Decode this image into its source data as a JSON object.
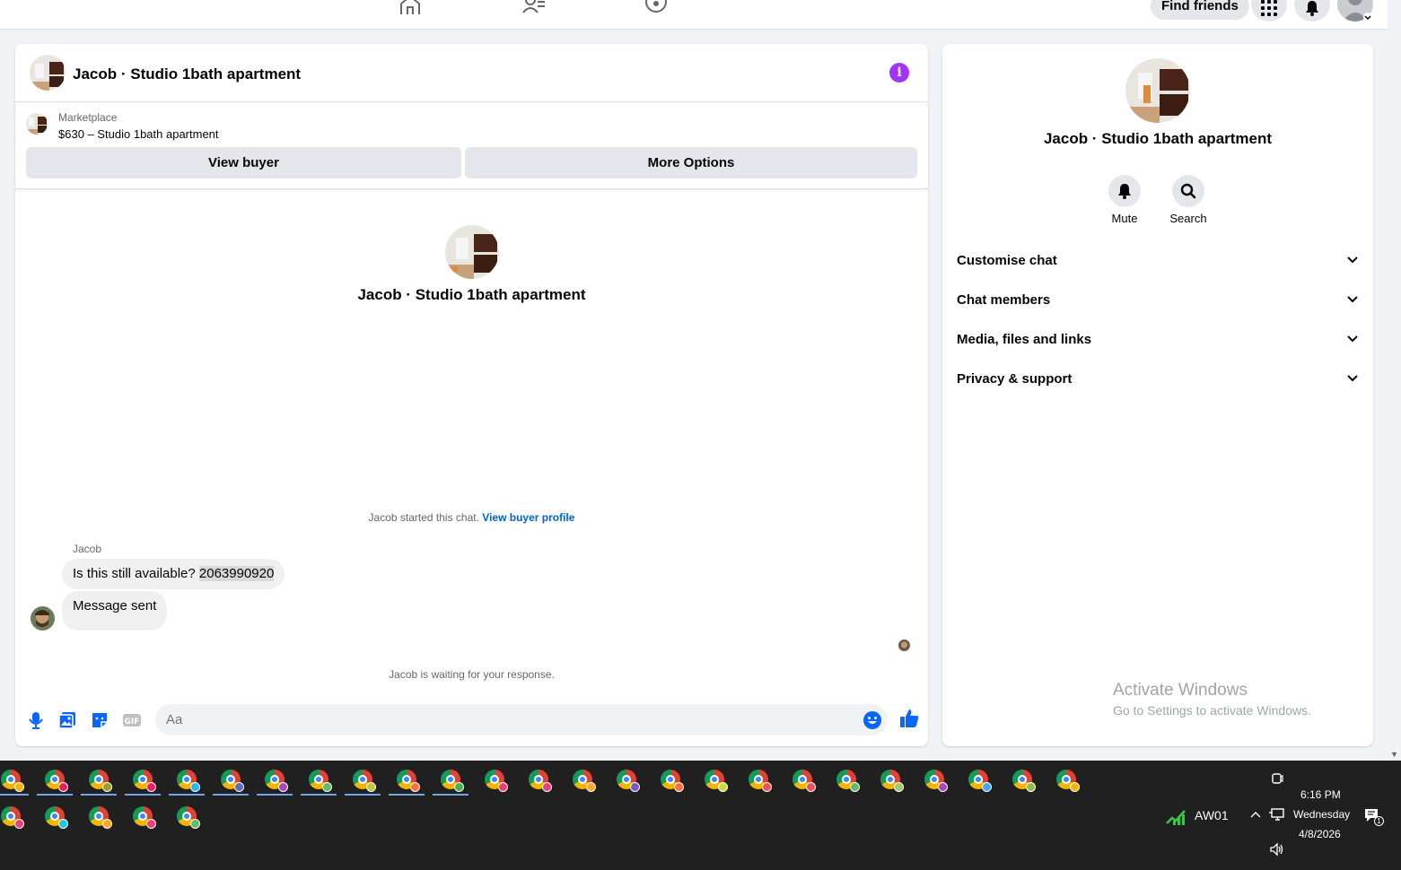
{
  "topnav": {
    "find_friends_label": "Find friends"
  },
  "chat": {
    "header_title": "Jacob · Studio 1bath apartment",
    "marketplace": {
      "label": "Marketplace",
      "item": "$630 – Studio 1bath apartment",
      "view_buyer_label": "View buyer",
      "more_options_label": "More Options"
    },
    "conversation_title": "Jacob · Studio 1bath apartment",
    "started_text": "Jacob started this chat.",
    "view_buyer_profile_link": "View buyer profile",
    "sender_name": "Jacob",
    "messages": [
      {
        "text": "Is this still available?",
        "highlight": "2063990920"
      },
      {
        "text": "Message sent"
      }
    ],
    "waiting_text": "Jacob is waiting for your response.",
    "input_placeholder": "Aa"
  },
  "right_panel": {
    "name": "Jacob · Studio 1bath apartment",
    "actions": [
      {
        "label": "Mute",
        "icon": "bell-icon"
      },
      {
        "label": "Search",
        "icon": "search-icon"
      }
    ],
    "sections": [
      {
        "label": "Customise chat"
      },
      {
        "label": "Chat members"
      },
      {
        "label": "Media, files and links"
      },
      {
        "label": "Privacy & support"
      }
    ],
    "watermark_title": "Activate Windows",
    "watermark_sub": "Go to Settings to activate Windows."
  },
  "taskbar": {
    "network_label": "AW01",
    "time": "6:16 PM",
    "day": "Wednesday",
    "date": "4/8/2026",
    "notification_count": "1"
  },
  "colors": {
    "accent_purple": "#a033ff",
    "link_blue": "#0064d1",
    "icon_blue": "#0866ff",
    "taskbar_bg": "#202020"
  }
}
